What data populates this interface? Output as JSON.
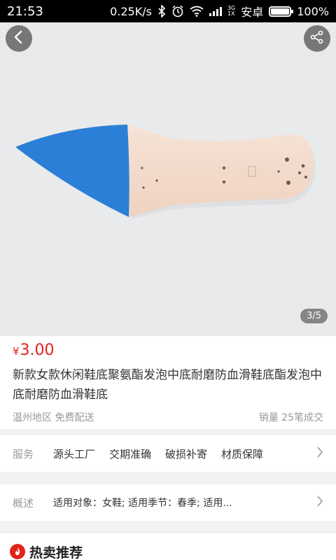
{
  "status_bar": {
    "time": "21:53",
    "speed": "0.25K/s",
    "net_type_top": "3G",
    "net_type_bottom": "1X",
    "carrier": "安卓",
    "battery": "100%",
    "battery_level": 1.0
  },
  "gallery": {
    "pager": "3/5",
    "back_icon": "back-arrow-icon",
    "share_icon": "share-icon"
  },
  "product": {
    "currency": "¥",
    "price": "3.00",
    "title": "新款女款休闲鞋底聚氨酯发泡中底耐磨防血滑鞋底酯发泡中底耐磨防血滑鞋底",
    "location": "温州地区",
    "shipping": "免费配送",
    "sales": "销量 25笔成交"
  },
  "service": {
    "label": "服务",
    "tags": [
      "源头工厂",
      "交期准确",
      "破损补寄",
      "材质保障"
    ]
  },
  "overview": {
    "label": "概述",
    "text": "适用对象：女鞋;  适用季节：春季;  适用..."
  },
  "hot": {
    "title": "热卖推荐"
  },
  "colors": {
    "price_red": "#e2231a",
    "insole_blue": "#2b7fd6",
    "insole_body": "#f2dccd"
  }
}
